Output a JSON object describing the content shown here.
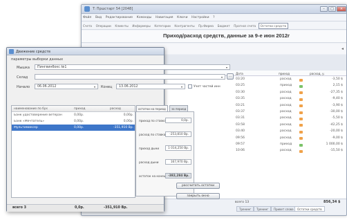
{
  "back_window": {
    "title": "T: Пршстарт 54 [2048]",
    "menu": [
      "Файл",
      "Вид",
      "Редактирование",
      "Команды",
      "Навигация",
      "Ключи",
      "Настройки",
      "?"
    ],
    "toolbar": [
      "Счета",
      "Операции",
      "Клиенты",
      "Информеры",
      "Категории",
      "Контрагенты",
      "Пр.Фирма",
      "Бюджет",
      "Прогноз счета",
      "Остатки средств"
    ],
    "toolbar_highlight": "Остатки средств",
    "header_title": "Приход/расход средств, данные за 9-е июн 2012г",
    "columns": [
      "Дата",
      "приход",
      "расход, у."
    ],
    "rows": [
      {
        "time": "03:20",
        "type": "расход",
        "amount": "-3,50 $"
      },
      {
        "time": "03:25",
        "type": "приход",
        "amount": "2,15 $"
      },
      {
        "time": "03:30",
        "type": "расход",
        "amount": "-27,35 $"
      },
      {
        "time": "03:35",
        "type": "расход",
        "amount": "-9,40 $"
      },
      {
        "time": "03:21",
        "type": "расход",
        "amount": "-3,90 $"
      },
      {
        "time": "03:37",
        "type": "расход",
        "amount": "-30,00 $"
      },
      {
        "time": "03:31",
        "type": "расход",
        "amount": "-5,50 $"
      },
      {
        "time": "03:58",
        "type": "расход",
        "amount": "-42,25 $"
      },
      {
        "time": "03:40",
        "type": "расход",
        "amount": "-20,00 $"
      },
      {
        "time": "09:56",
        "type": "расход",
        "amount": "-9,00 $"
      },
      {
        "time": "09:57",
        "type": "приход",
        "amount": "1 000,00 $"
      },
      {
        "time": "10:06",
        "type": "расход",
        "amount": "-15,50 $"
      }
    ],
    "status_left": "всего 13",
    "status_right": "856,34 $",
    "bottom_tabs": [
      "Тренинг",
      "Тренинг",
      "Привет слова",
      "Остатки средств"
    ]
  },
  "dialog": {
    "title": "Движение средств",
    "section": "параметры выборки данных",
    "account_label": "Мышка",
    "account_value": "Пингвинбокс №1",
    "warehouse_label": "Склад",
    "warehouse_value": "",
    "start_label": "Начало",
    "start_value": "06.06.2012",
    "end_label": "Конец",
    "end_value": "13.06.2012",
    "checkbox_label": "Учет частей инн",
    "list_headers": [
      "наименование по бух",
      "приход",
      "расход"
    ],
    "list_rows": [
      {
        "name": "Банк удостоверение ветеран",
        "in": "0,00р.",
        "out": "0,00р."
      },
      {
        "name": "Банк «Мечтатель»",
        "in": "0,00р.",
        "out": "0,00р."
      },
      {
        "name": "Мультимиксер",
        "in": "0,00р.",
        "out": "-351,910 Вр."
      }
    ],
    "tabs": [
      "остатки на период",
      "за период"
    ],
    "fields": [
      {
        "label": "приход по ставкам",
        "value": "0,0р."
      },
      {
        "label": "расход по ставкам",
        "value": "-253,810 Вр."
      },
      {
        "label": "приход дыни",
        "value": "1 014,250 Вр."
      },
      {
        "label": "расход дыни",
        "value": "167,970 Вр."
      },
      {
        "label": "остаток на конец",
        "value": "-382,284 Вр."
      }
    ],
    "calc_button": "рассчитать остатки",
    "close_button": "закрыть окно",
    "status_left": "всего 3",
    "status_in": "0,0р.",
    "status_out": "-351,910 Вр."
  }
}
